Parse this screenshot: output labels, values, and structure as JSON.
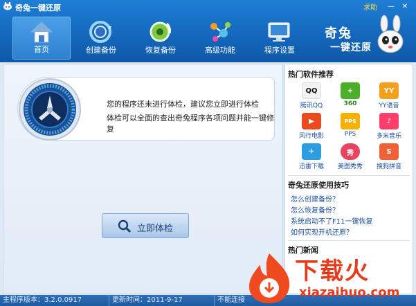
{
  "window": {
    "title": "奇兔一键还原",
    "help": "求助",
    "minimize": "—",
    "close": "✕"
  },
  "nav": {
    "items": [
      {
        "label": "首页",
        "icon": "house-icon"
      },
      {
        "label": "创建备份",
        "icon": "backup-icon"
      },
      {
        "label": "恢复备份",
        "icon": "restore-icon"
      },
      {
        "label": "高级功能",
        "icon": "molecule-icon"
      },
      {
        "label": "程序设置",
        "icon": "monitor-icon"
      }
    ]
  },
  "brand": {
    "line1": "奇兔",
    "line2": "一键还原"
  },
  "check": {
    "msg1": "您的程序还未进行体检，建议您立即进行体检",
    "msg2": "体检可以全面的查出奇兔程序各项问题并能一键修复",
    "button": "立即体检"
  },
  "side": {
    "hot_software_title": "热门软件推荐",
    "software": [
      {
        "label": "腾讯QQ",
        "badge": "QQ",
        "color": "#f2f2f2"
      },
      {
        "label": "360",
        "badge": "+",
        "color": "#4caf2a"
      },
      {
        "label": "YY语音",
        "badge": "YY",
        "color": "#f2a11c"
      },
      {
        "label": "风行电影",
        "badge": "▶",
        "color": "#e94a1e"
      },
      {
        "label": "PPS",
        "badge": "PPS",
        "color": "#f5b000"
      },
      {
        "label": "多米音乐",
        "badge": "♪",
        "color": "#ff3e6a"
      },
      {
        "label": "迅雷下载",
        "badge": "✈",
        "color": "#2b9de0"
      },
      {
        "label": "美图秀秀",
        "badge": "秀",
        "color": "#e8435f"
      },
      {
        "label": "搜狗拼音",
        "badge": "S",
        "color": "#f0613a"
      }
    ],
    "tips_title": "奇兔还原使用技巧",
    "tips": [
      "怎么创建备份？",
      "怎么恢复备份？",
      "系统启动不了F11一键恢复",
      "如何实现开机还原？"
    ],
    "news_title": "热门新闻"
  },
  "status": {
    "version": "主程序版本：3.2.0.0917",
    "updated": "更新时间：2011-9-17",
    "network": "不能连接"
  },
  "watermark": {
    "text": "下载火",
    "url": "xiazaihuo.com"
  }
}
